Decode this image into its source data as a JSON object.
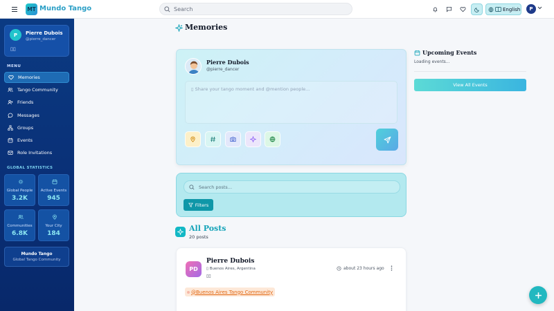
{
  "header": {
    "logo_badge": "MT",
    "app_name": "Mundo Tango",
    "search_placeholder": "Search",
    "language": "English",
    "user_initial": "P"
  },
  "sidebar": {
    "profile": {
      "initial": "P",
      "name": "Pierre Dubois",
      "handle": "@pierre_dancer",
      "box": "▯▯"
    },
    "menu_title": "MENU",
    "items": [
      {
        "label": "Memories",
        "icon": "heart-icon",
        "active": true
      },
      {
        "label": "Tango Community",
        "icon": "users-icon"
      },
      {
        "label": "Friends",
        "icon": "user-plus-icon"
      },
      {
        "label": "Messages",
        "icon": "chat-icon"
      },
      {
        "label": "Groups",
        "icon": "network-icon"
      },
      {
        "label": "Events",
        "icon": "calendar-icon"
      },
      {
        "label": "Role Invitations",
        "icon": "mail-icon"
      }
    ],
    "stats_title": "GLOBAL STATISTICS",
    "stats": [
      {
        "label": "Global People",
        "value": "3.2K",
        "icon": "sparkle-icon"
      },
      {
        "label": "Active Events",
        "value": "945",
        "icon": "calendar-icon"
      },
      {
        "label": "Communities",
        "value": "6.8K",
        "icon": "users-icon"
      },
      {
        "label": "Your City",
        "value": "184",
        "icon": "map-pin-icon"
      }
    ],
    "brand": {
      "title": "Mundo Tango",
      "subtitle": "Global Tango Community"
    }
  },
  "main": {
    "title": "Memories",
    "composer": {
      "name": "Pierre Dubois",
      "handle": "@pierre_dancer",
      "placeholder": "▯ Share your tango moment and @mention people..."
    },
    "search_posts_placeholder": "Search posts...",
    "filters_label": "Filters",
    "all_posts_title": "All Posts",
    "post_count": "20 posts",
    "post": {
      "initials": "PD",
      "name": "Pierre Dubois",
      "location": "▯ Buenos Aires, Argentina",
      "box": "▯▯",
      "time": "about 23 hours ago",
      "mention": "@Buenos Aires Tango Community"
    }
  },
  "right": {
    "title": "Upcoming Events",
    "loading": "Loading events...",
    "button": "View All Events"
  },
  "colors": {
    "accent": "#14a3b8",
    "sidebar": "#0b3a82",
    "mention": "#e26a16"
  }
}
